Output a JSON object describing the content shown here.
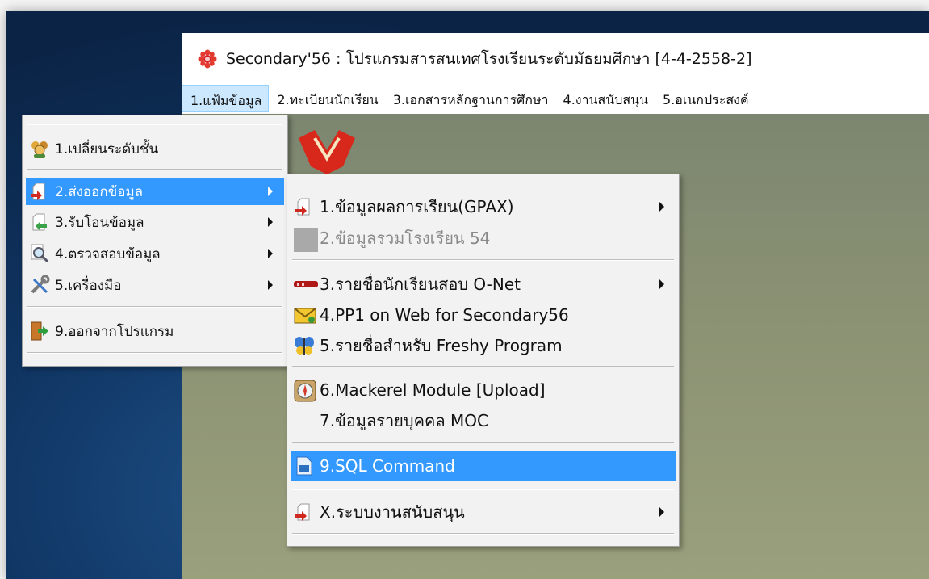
{
  "window": {
    "title": "Secondary'56 : โปรแกรมสารสนเทศโรงเรียนระดับมัธยมศึกษา [4-4-2558-2]"
  },
  "menubar": {
    "items": [
      {
        "label": "1.แฟ้มข้อมูล"
      },
      {
        "label": "2.ทะเบียนนักเรียน"
      },
      {
        "label": "3.เอกสารหลักฐานการศึกษา"
      },
      {
        "label": "4.งานสนับสนุน"
      },
      {
        "label": "5.อเนกประสงค์"
      }
    ]
  },
  "file_menu": {
    "items": [
      {
        "label": "1.เปลี่ยนระดับชั้น",
        "icon": "people-icon"
      },
      {
        "label": "2.ส่งออกข้อมูล",
        "icon": "export-arrow-icon",
        "submenu": true,
        "highlighted": true
      },
      {
        "label": "3.รับโอนข้อมูล",
        "icon": "import-arrow-icon",
        "submenu": true
      },
      {
        "label": "4.ตรวจสอบข้อมูล",
        "icon": "magnifier-icon",
        "submenu": true
      },
      {
        "label": "5.เครื่องมือ",
        "icon": "tools-icon",
        "submenu": true
      },
      {
        "label": "9.ออกจากโปรแกรม",
        "icon": "exit-door-icon"
      }
    ]
  },
  "export_submenu": {
    "items": [
      {
        "label": "1.ข้อมูลผลการเรียน(GPAX)",
        "icon": "export-arrow-icon",
        "submenu": true
      },
      {
        "label": "2.ข้อมูลรวมโรงเรียน 54",
        "icon": "disabled-placeholder-icon",
        "disabled": true
      },
      {
        "label": "3.รายชื่อนักเรียนสอบ O-Net",
        "icon": "red-key-icon",
        "submenu": true
      },
      {
        "label": "4.PP1 on Web for Secondary56",
        "icon": "envelope-icon"
      },
      {
        "label": "5.รายชื่อสำหรับ Freshy Program",
        "icon": "butterfly-icon"
      },
      {
        "label": "6.Mackerel Module [Upload]",
        "icon": "compass-icon"
      },
      {
        "label": "7.ข้อมูลรายบุคคล MOC",
        "icon": ""
      },
      {
        "label": "9.SQL Command",
        "icon": "sql-document-icon",
        "highlighted": true
      },
      {
        "label": "X.ระบบงานสนับสนุน",
        "icon": "export-arrow-icon",
        "submenu": true
      }
    ]
  },
  "colors": {
    "highlight": "#3399ff",
    "menubar_active": "#cce8ff",
    "menu_background": "#f2f2f2"
  }
}
